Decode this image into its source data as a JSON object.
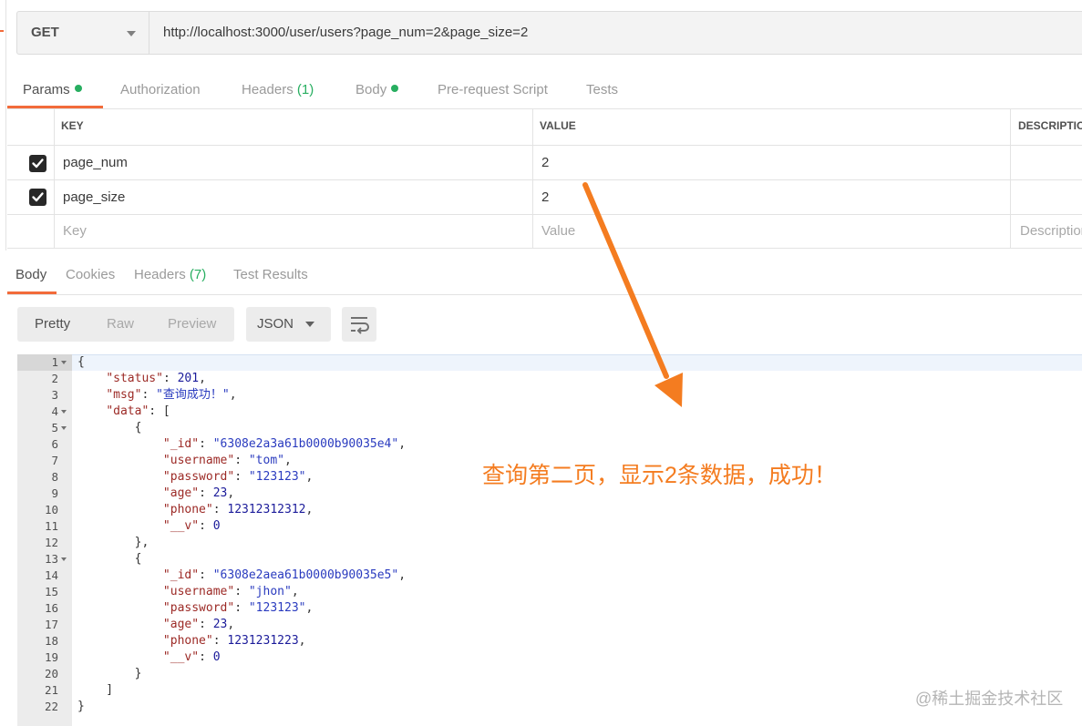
{
  "request": {
    "method": "GET",
    "url": "http://localhost:3000/user/users?page_num=2&page_size=2"
  },
  "request_tabs": [
    {
      "label": "Params",
      "active": true,
      "dot": true
    },
    {
      "label": "Authorization",
      "active": false
    },
    {
      "label": "Headers",
      "count": "(1)",
      "active": false
    },
    {
      "label": "Body",
      "active": false,
      "dot": true
    },
    {
      "label": "Pre-request Script",
      "active": false
    },
    {
      "label": "Tests",
      "active": false
    }
  ],
  "params_table": {
    "headers": [
      "KEY",
      "VALUE",
      "DESCRIPTION"
    ],
    "rows": [
      {
        "checked": true,
        "key": "page_num",
        "value": "2"
      },
      {
        "checked": true,
        "key": "page_size",
        "value": "2"
      }
    ],
    "placeholder": {
      "key": "Key",
      "value": "Value",
      "description": "Description"
    }
  },
  "response_tabs": [
    {
      "label": "Body",
      "active": true
    },
    {
      "label": "Cookies",
      "active": false
    },
    {
      "label": "Headers",
      "count": "(7)",
      "active": false
    },
    {
      "label": "Test Results",
      "active": false
    }
  ],
  "format_buttons": [
    "Pretty",
    "Raw",
    "Preview"
  ],
  "format_select": "JSON",
  "code_lines": [
    "{",
    "    \"status\": 201,",
    "    \"msg\": \"查询成功！\",",
    "    \"data\": [",
    "        {",
    "            \"_id\": \"6308e2a3a61b0000b90035e4\",",
    "            \"username\": \"tom\",",
    "            \"password\": \"123123\",",
    "            \"age\": 23,",
    "            \"phone\": 12312312312,",
    "            \"__v\": 0",
    "        },",
    "        {",
    "            \"_id\": \"6308e2aea61b0000b90035e5\",",
    "            \"username\": \"jhon\",",
    "            \"password\": \"123123\",",
    "            \"age\": 23,",
    "            \"phone\": 1231231223,",
    "            \"__v\": 0",
    "        }",
    "    ]",
    "}"
  ],
  "fold_lines": [
    1,
    4,
    5,
    13
  ],
  "annotation": "查询第二页，显示2条数据，成功！",
  "watermark": "@稀土掘金技术社区",
  "colors": {
    "accent": "#f26b3a",
    "green": "#27ae60",
    "arrow": "#f47c20"
  }
}
